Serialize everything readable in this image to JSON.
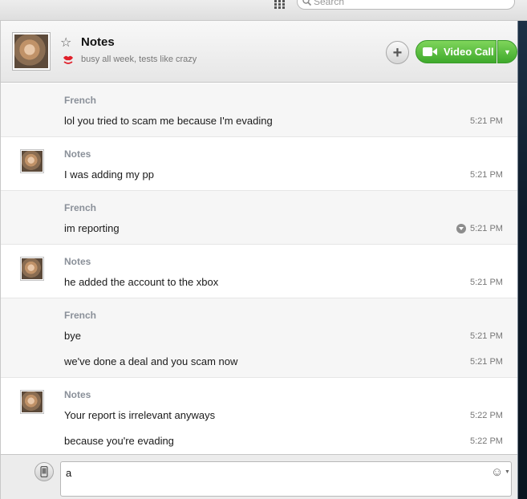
{
  "search": {
    "placeholder": "Search"
  },
  "contact": {
    "name": "Notes",
    "mood": "busy all week, tests like crazy"
  },
  "header": {
    "video_call_label": "Video Call",
    "add_label": "+"
  },
  "colors": {
    "accent_green": "#4cbb35",
    "french_row_bg": "#f6f6f6"
  },
  "groups": [
    {
      "sender": "French",
      "messages": [
        {
          "text": "lol you tried to scam me because I'm evading",
          "time": "5:21 PM"
        }
      ]
    },
    {
      "sender": "Notes",
      "messages": [
        {
          "text": "I was adding my pp",
          "time": "5:21 PM"
        }
      ]
    },
    {
      "sender": "French",
      "messages": [
        {
          "text": "im reporting",
          "time": "5:21 PM"
        }
      ]
    },
    {
      "sender": "Notes",
      "messages": [
        {
          "text": "he added the account to the xbox",
          "time": "5:21 PM"
        }
      ]
    },
    {
      "sender": "French",
      "messages": [
        {
          "text": "bye",
          "time": "5:21 PM"
        },
        {
          "text": "we've done a deal and you scam now",
          "time": "5:21 PM"
        }
      ]
    },
    {
      "sender": "Notes",
      "messages": [
        {
          "text": "Your report is irrelevant anyways",
          "time": "5:22 PM"
        },
        {
          "text": "because you're evading",
          "time": "5:22 PM"
        }
      ]
    }
  ],
  "composer": {
    "value": "a"
  },
  "icons": [
    "grid-icon",
    "search-icon",
    "star-icon",
    "mood-lips-icon",
    "plus-icon",
    "video-camera-icon",
    "chevron-down-icon",
    "message-menu-icon",
    "phone-icon",
    "emoji-icon"
  ]
}
